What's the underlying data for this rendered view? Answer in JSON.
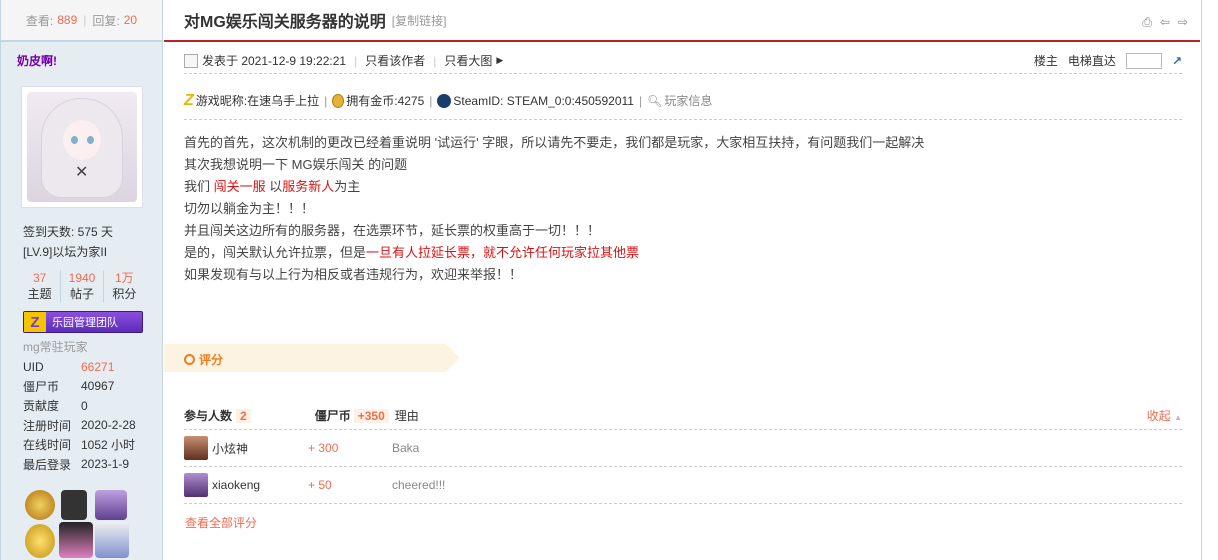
{
  "stats": {
    "views_label": "查看:",
    "views": "889",
    "replies_label": "回复:",
    "replies": "20"
  },
  "author": {
    "name": "奶皮啊!"
  },
  "profile": {
    "signin": "签到天数: 575 天",
    "level": "[LV.9]以坛为家II",
    "stats": [
      {
        "value": "37",
        "label": "主题"
      },
      {
        "value": "1940",
        "label": "帖子"
      },
      {
        "value": "1万",
        "label": "积分"
      }
    ],
    "team": "乐园管理团队",
    "group": "mg常驻玩家",
    "info": [
      {
        "k": "UID",
        "v": "66271",
        "red": true
      },
      {
        "k": "僵尸币",
        "v": "40967",
        "red": false
      },
      {
        "k": "贡献度",
        "v": "0",
        "red": false
      },
      {
        "k": "注册时间",
        "v": "2020-2-28",
        "red": false
      },
      {
        "k": "在线时间",
        "v": "1052 小时",
        "red": false
      },
      {
        "k": "最后登录",
        "v": "2023-1-9",
        "red": false
      }
    ]
  },
  "thread": {
    "title": "对MG娱乐闯关服务器的说明",
    "copy_link": "[复制链接]"
  },
  "meta": {
    "posted": "发表于 2021-12-9 19:22:21",
    "only_author": "只看该作者",
    "big_image": "只看大图",
    "floor": "楼主",
    "jump": "电梯直达"
  },
  "gameinfo": {
    "nick": "游戏昵称:在速乌手上拉",
    "gold": "拥有金币:4275",
    "steam": "SteamID: STEAM_0:0:450592011",
    "player": "玩家信息"
  },
  "content": {
    "l1": "首先的首先，这次机制的更改已经着重说明 '试运行' 字眼，所以请先不要走，我们都是玩家，大家相互扶持，有问题我们一起解决",
    "l2": "其次我想说明一下 MG娱乐闯关 的问题",
    "l3a": "我们 ",
    "l3b": "闯关一服",
    "l3c": " 以",
    "l3d": "服务新人",
    "l3e": "为主",
    "l4": "切勿以躺金为主！！！",
    "l5": "并且闯关这边所有的服务器，在选票环节，延长票的权重高于一切！！！",
    "l6a": "是的，闯关默认允许拉票，但是",
    "l6b": "一旦有人拉延长票，就不允许任何玩家拉其他票",
    "l7": "如果发现有与以上行为相反或者违规行为，欢迎来举报！！"
  },
  "rating": {
    "label": "评分",
    "participants_label": "参与人数",
    "participants": "2",
    "currency_label": "僵尸币",
    "total": "+350",
    "reason_label": "理由",
    "fold": "收起",
    "rows": [
      {
        "name": "小炫神",
        "score": "+ 300",
        "reason": "Baka"
      },
      {
        "name": "xiaokeng",
        "score": "+ 50",
        "reason": "cheered!!!"
      }
    ],
    "view_all": "查看全部评分"
  }
}
